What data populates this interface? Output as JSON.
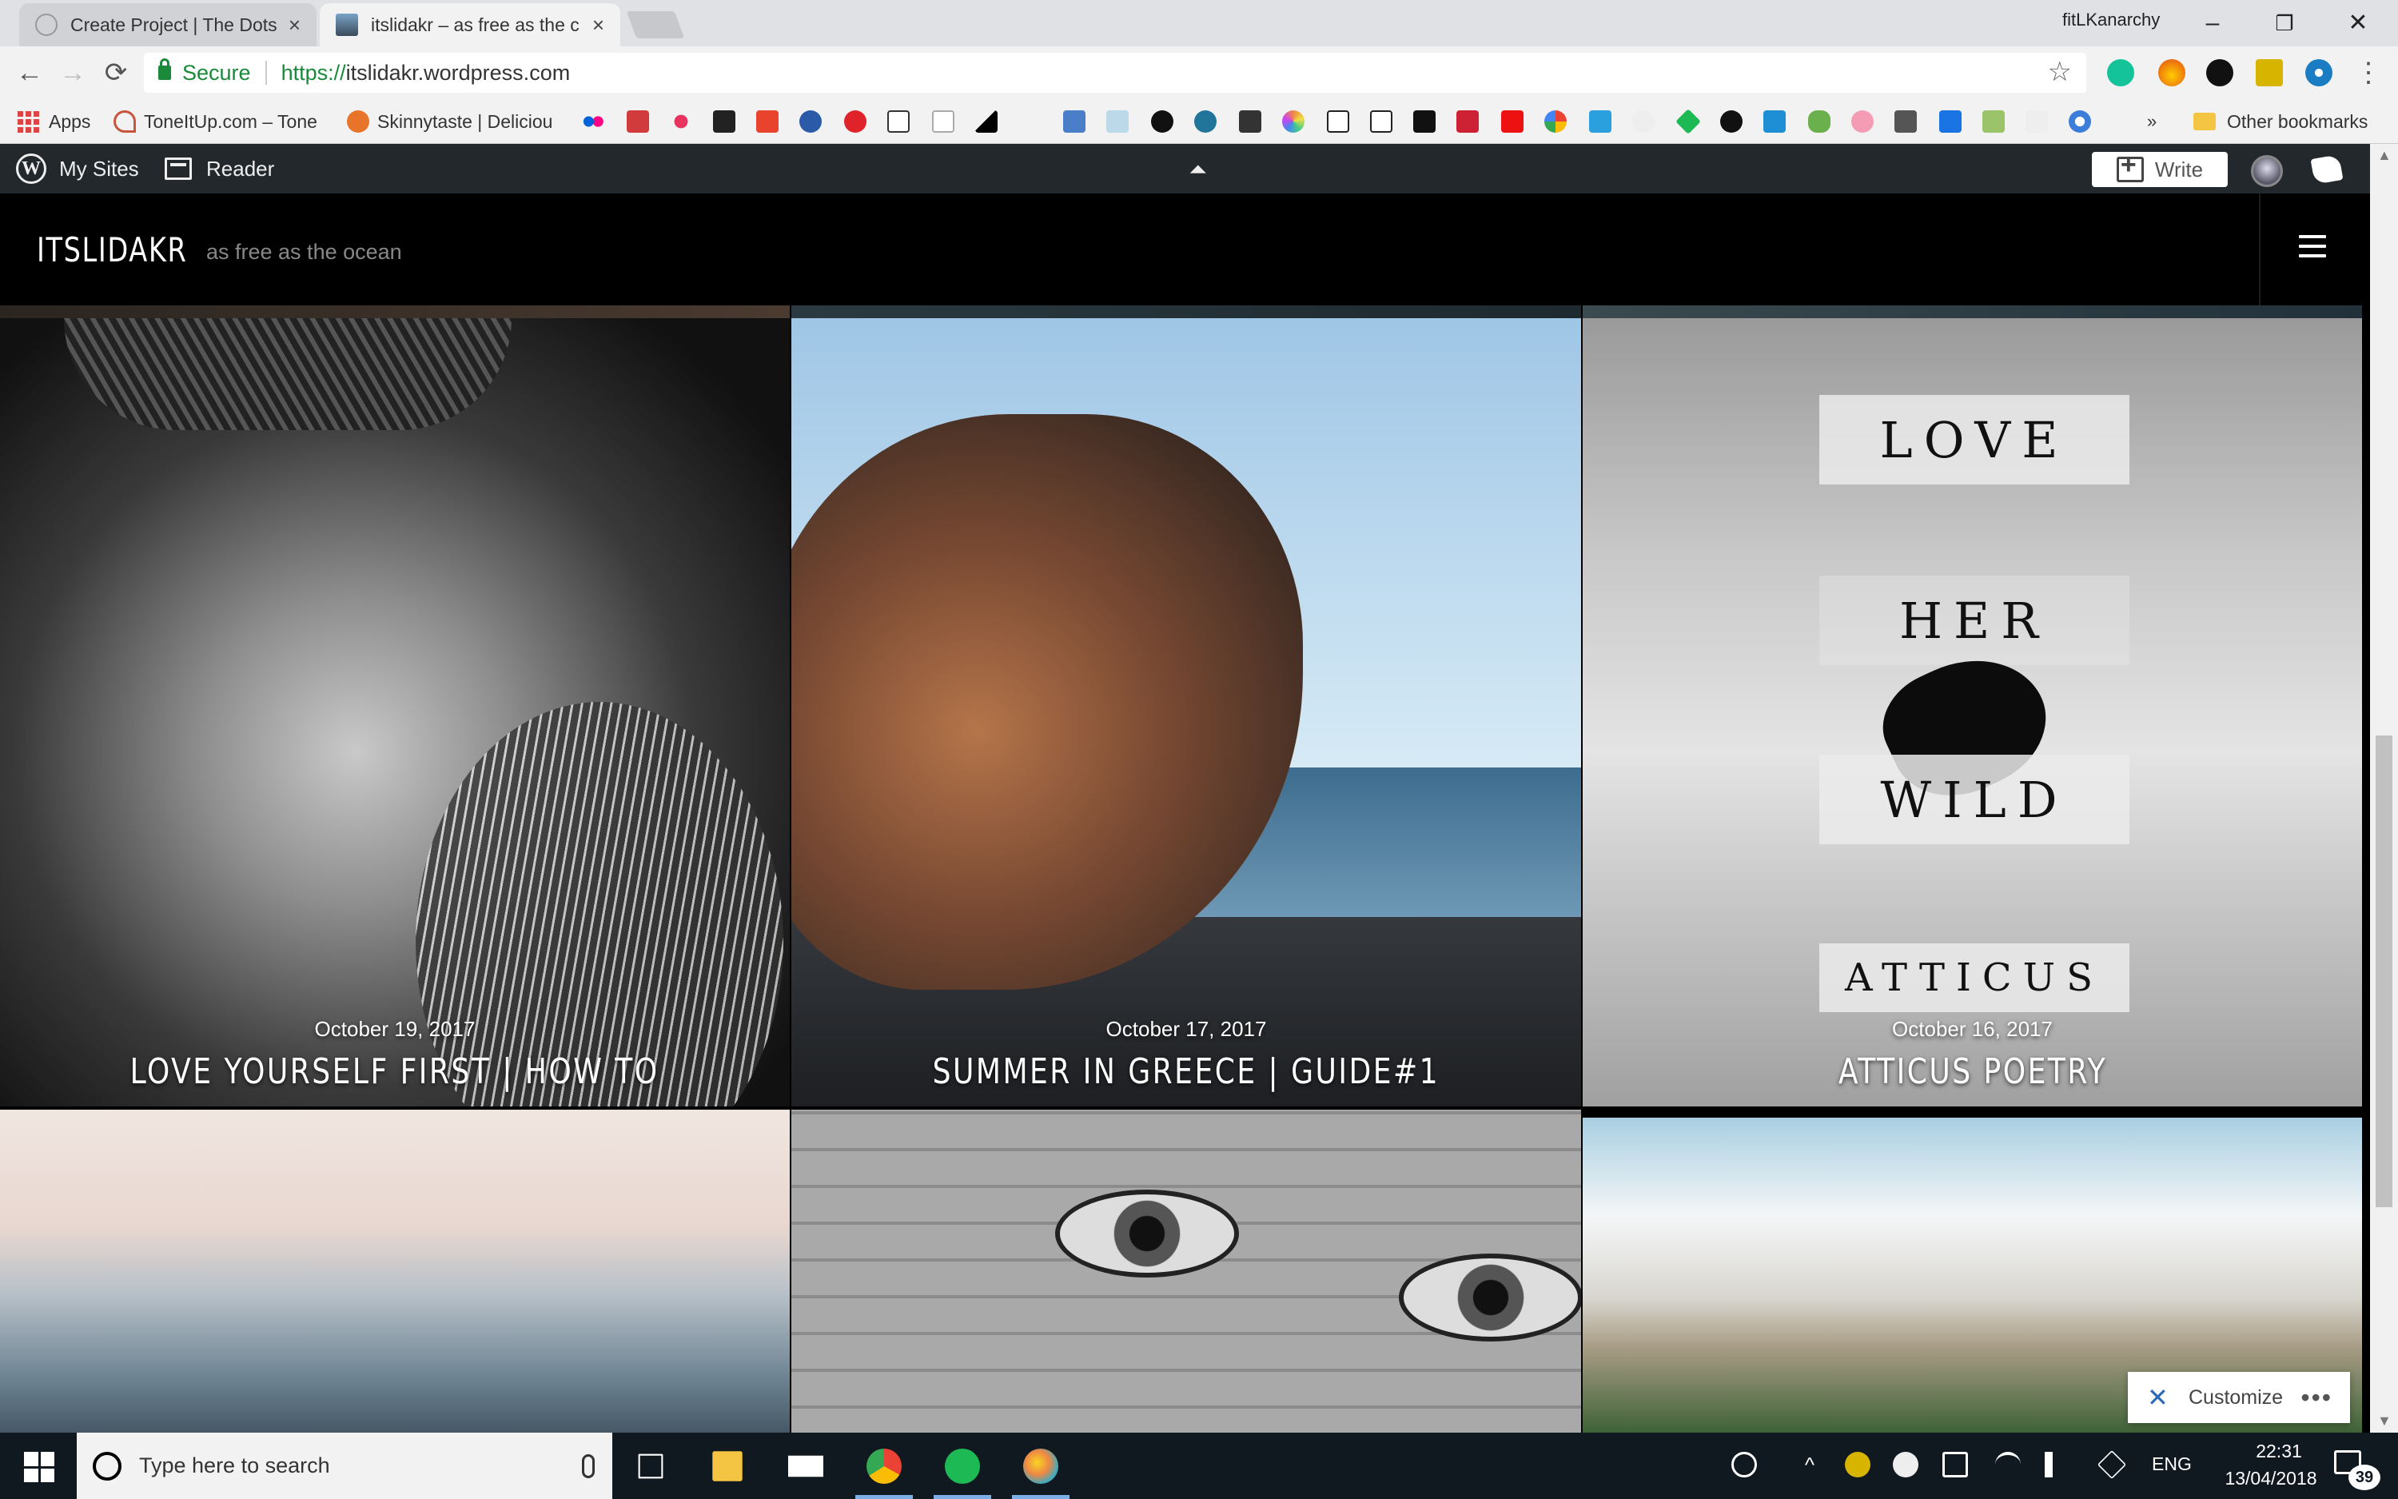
{
  "browser": {
    "tabs": [
      {
        "title": "Create Project | The Dots",
        "close": "×"
      },
      {
        "title": "itslidakr – as free as the c",
        "close": "×"
      }
    ],
    "profile_name": "fitLKanarchy",
    "window_controls": {
      "minimize": "–",
      "restore": "❐",
      "close": "✕"
    },
    "nav": {
      "back": "←",
      "forward": "→",
      "reload": "⟳"
    },
    "address": {
      "secure_label": "Secure",
      "url_scheme": "https://",
      "url_rest": "itslidakr.wordpress.com"
    },
    "star": "☆",
    "menu": "⋮"
  },
  "bookmarks": {
    "apps_label": "Apps",
    "items": [
      {
        "label": "ToneItUp.com – Tone",
        "color": "#c8553d"
      },
      {
        "label": "Skinnytaste | Deliciou",
        "color": "#e8742a"
      }
    ],
    "more": "»",
    "other_label": "Other bookmarks"
  },
  "wpadmin": {
    "my_sites_label": "My Sites",
    "reader_label": "Reader",
    "collapse_glyph": "⏶",
    "write_label": "Write"
  },
  "site": {
    "title": "ITSLIDAKR",
    "tagline": "as free as the ocean"
  },
  "posts": [
    {
      "date": "October 19, 2017",
      "title": "LOVE YOURSELF FIRST | HOW TO"
    },
    {
      "date": "October 17, 2017",
      "title": "SUMMER IN GREECE | GUIDE#1"
    },
    {
      "date": "October 16, 2017",
      "title": "ATTICUS POETRY",
      "image_words": [
        "LOVE",
        "HER",
        "WILD",
        "ATTICUS"
      ]
    }
  ],
  "customize": {
    "label": "Customize",
    "icon": "wrench-icon",
    "more": "•••"
  },
  "taskbar": {
    "search_placeholder": "Type here to search",
    "language": "ENG",
    "time": "22:31",
    "date": "13/04/2018",
    "notification_count": "39"
  },
  "colors": {
    "wp_admin_bar": "#23282d",
    "secure_green": "#1a8a3a",
    "taskbar": "#101820"
  }
}
